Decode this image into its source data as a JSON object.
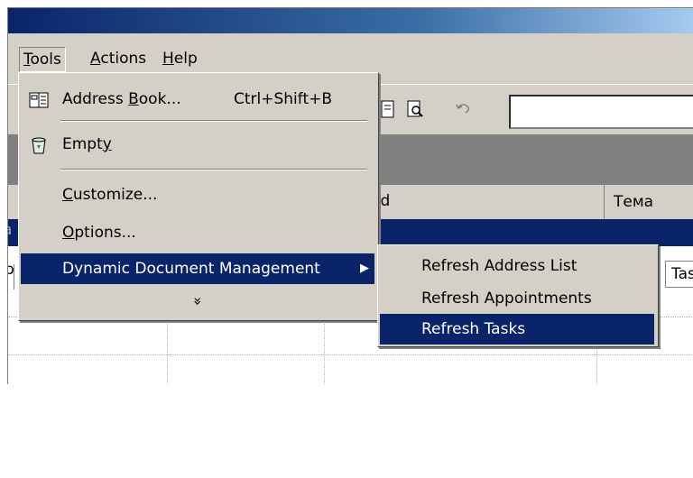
{
  "menubar": {
    "tools": {
      "prefix": "",
      "mnemonic": "T",
      "rest": "ools"
    },
    "actions": {
      "prefix": "",
      "mnemonic": "A",
      "rest": "ctions"
    },
    "help": {
      "prefix": "",
      "mnemonic": "H",
      "rest": "elp"
    }
  },
  "column_headers": {
    "sent_fragment": "ed",
    "subject": "Тема"
  },
  "list": {
    "partial_left_top": "a",
    "partial_left_row": "p",
    "partial_right_cell": "Tas"
  },
  "tools_menu": {
    "address_book": {
      "prefix": "Address ",
      "mnemonic": "B",
      "rest": "ook...",
      "shortcut": "Ctrl+Shift+B"
    },
    "empty": {
      "prefix": "Empt",
      "mnemonic": "y",
      "rest": ""
    },
    "customize": {
      "prefix": "",
      "mnemonic": "C",
      "rest": "ustomize..."
    },
    "options": {
      "prefix": "",
      "mnemonic": "O",
      "rest": "ptions..."
    },
    "ddm": {
      "label": "Dynamic Document Management"
    },
    "expand_glyph": "»"
  },
  "submenu": {
    "refresh_address_list": "Refresh Address List",
    "refresh_appointments": "Refresh Appointments",
    "refresh_tasks": "Refresh Tasks"
  },
  "colors": {
    "highlight": "#0a246a",
    "face": "#d4d0c8",
    "shadow": "#808080"
  }
}
